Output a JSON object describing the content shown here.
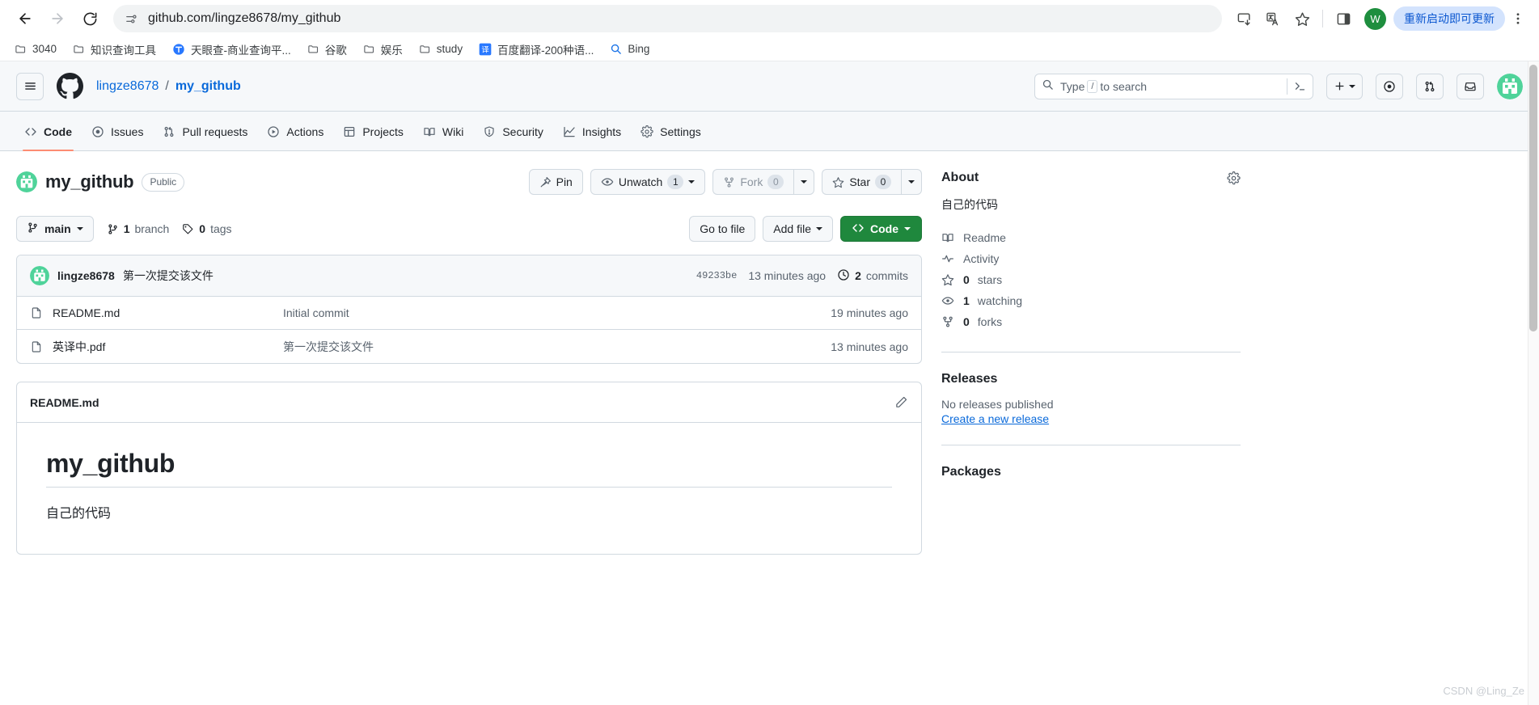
{
  "browser": {
    "back_icon": "arrow-left-icon",
    "forward_icon": "arrow-right-icon",
    "reload_icon": "reload-icon",
    "site_info_icon": "site-settings-icon",
    "url": "github.com/lingze8678/my_github",
    "install_icon": "install-app-icon",
    "translate_icon": "translate-icon",
    "bookmark_icon": "star-icon",
    "sidepanel_icon": "side-panel-icon",
    "profile_initial": "W",
    "update_label": "重新启动即可更新",
    "menu_icon": "kebab-menu-icon",
    "bookmarks": [
      {
        "label": "3040",
        "icon": "folder-icon"
      },
      {
        "label": "知识查询工具",
        "icon": "folder-icon"
      },
      {
        "label": "天眼查-商业查询平...",
        "icon": "tianyancha-icon"
      },
      {
        "label": "谷歌",
        "icon": "folder-icon"
      },
      {
        "label": "娱乐",
        "icon": "folder-icon"
      },
      {
        "label": "study",
        "icon": "folder-icon"
      },
      {
        "label": "百度翻译-200种语...",
        "icon": "baidu-translate-icon"
      },
      {
        "label": "Bing",
        "icon": "search-icon"
      }
    ]
  },
  "gh_header": {
    "menu_icon": "hamburger-icon",
    "logo_icon": "github-mark-icon",
    "owner": "lingze8678",
    "separator": "/",
    "repo": "my_github",
    "search_placeholder_prefix": "Type",
    "search_key": "/",
    "search_placeholder_suffix": "to search",
    "command_palette_icon": "terminal-icon",
    "create_new_icon": "plus-icon",
    "issues_icon": "issue-opened-icon",
    "pull_requests_icon": "git-pull-request-icon",
    "notifications_icon": "inbox-icon",
    "avatar_icon": "user-avatar"
  },
  "repo_nav": {
    "tabs": [
      {
        "label": "Code",
        "icon": "code-icon",
        "active": true
      },
      {
        "label": "Issues",
        "icon": "issue-opened-icon",
        "active": false
      },
      {
        "label": "Pull requests",
        "icon": "git-pull-request-icon",
        "active": false
      },
      {
        "label": "Actions",
        "icon": "play-icon",
        "active": false
      },
      {
        "label": "Projects",
        "icon": "table-icon",
        "active": false
      },
      {
        "label": "Wiki",
        "icon": "book-icon",
        "active": false
      },
      {
        "label": "Security",
        "icon": "shield-icon",
        "active": false
      },
      {
        "label": "Insights",
        "icon": "graph-icon",
        "active": false
      },
      {
        "label": "Settings",
        "icon": "gear-icon",
        "active": false
      }
    ]
  },
  "repo": {
    "name": "my_github",
    "visibility": "Public",
    "avatar_icon": "repo-owner-avatar",
    "actions": {
      "pin_label": "Pin",
      "pin_icon": "pin-icon",
      "watch_label": "Unwatch",
      "watch_icon": "eye-icon",
      "watch_count": "1",
      "fork_label": "Fork",
      "fork_icon": "repo-forked-icon",
      "fork_count": "0",
      "star_label": "Star",
      "star_icon": "star-icon",
      "star_count": "0"
    }
  },
  "branch_bar": {
    "branch_name": "main",
    "branch_icon": "git-branch-icon",
    "branch_count_label": "branch",
    "branch_count": "1",
    "tag_count_label": "tags",
    "tag_count": "0",
    "tag_icon": "tag-icon",
    "go_to_file": "Go to file",
    "add_file": "Add file",
    "code_label": "Code",
    "code_icon": "code-icon"
  },
  "commit_bar": {
    "author": "lingze8678",
    "message": "第一次提交该文件",
    "sha": "49233be",
    "time": "13 minutes ago",
    "commits_count": "2",
    "commits_label": "commits",
    "history_icon": "history-icon"
  },
  "files": [
    {
      "name": "README.md",
      "icon": "file-icon",
      "message": "Initial commit",
      "time": "19 minutes ago"
    },
    {
      "name": "英译中.pdf",
      "icon": "file-icon",
      "message": "第一次提交该文件",
      "time": "13 minutes ago"
    }
  ],
  "readme": {
    "filename": "README.md",
    "edit_icon": "pencil-icon",
    "heading": "my_github",
    "paragraph": "自己的代码"
  },
  "sidebar": {
    "about_title": "About",
    "settings_icon": "gear-icon",
    "description": "自己的代码",
    "items": [
      {
        "label": "Readme",
        "icon": "book-icon",
        "value": ""
      },
      {
        "label": "Activity",
        "icon": "pulse-icon",
        "value": ""
      },
      {
        "label": "stars",
        "icon": "star-icon",
        "value": "0"
      },
      {
        "label": "watching",
        "icon": "eye-icon",
        "value": "1"
      },
      {
        "label": "forks",
        "icon": "repo-forked-icon",
        "value": "0"
      }
    ],
    "releases_title": "Releases",
    "releases_empty": "No releases published",
    "releases_link": "Create a new release",
    "packages_title": "Packages"
  },
  "watermark": "CSDN @Ling_Ze",
  "colors": {
    "accent": "#0969da",
    "primary_button": "#1f883d",
    "active_tab_underline": "#fd8c73",
    "header_bg": "#f6f8fa",
    "border": "#d1d9e0",
    "update_pill_bg": "#d3e3fd",
    "update_pill_text": "#0b57d0"
  }
}
